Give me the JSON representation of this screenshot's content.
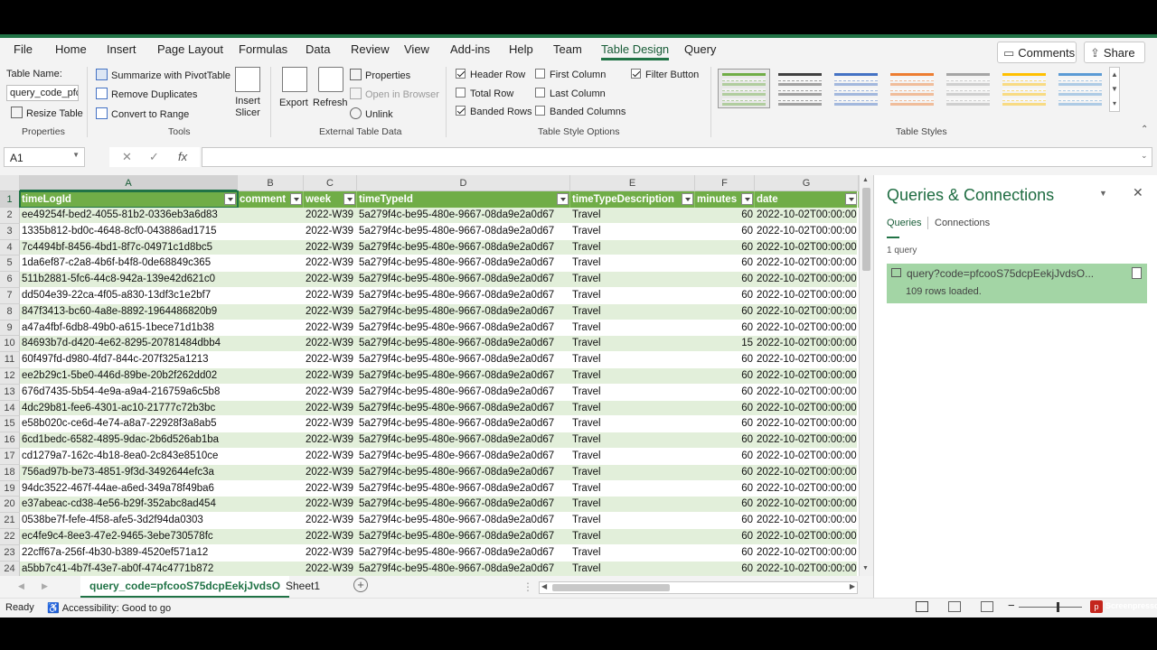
{
  "ribbon_tabs": [
    "File",
    "Home",
    "Insert",
    "Page Layout",
    "Formulas",
    "Data",
    "Review",
    "View",
    "Add-ins",
    "Help",
    "Team",
    "Table Design",
    "Query"
  ],
  "top_buttons": {
    "comments": "Comments",
    "share": "Share"
  },
  "ribbon": {
    "properties": {
      "table_name_label": "Table Name:",
      "table_name_value": "query_code_pfcc",
      "resize": "Resize Table",
      "group": "Properties"
    },
    "tools": {
      "summarize": "Summarize with PivotTable",
      "remove_dup": "Remove Duplicates",
      "convert": "Convert to Range",
      "insert_slicer": "Insert Slicer",
      "group": "Tools"
    },
    "external": {
      "export": "Export",
      "refresh": "Refresh",
      "properties": "Properties",
      "open_browser": "Open in Browser",
      "unlink": "Unlink",
      "group": "External Table Data"
    },
    "style_options": {
      "header_row": "Header Row",
      "total_row": "Total Row",
      "banded_rows": "Banded Rows",
      "first_column": "First Column",
      "last_column": "Last Column",
      "banded_columns": "Banded Columns",
      "filter_button": "Filter Button",
      "group": "Table Style Options"
    },
    "table_styles": {
      "group": "Table Styles",
      "colors": [
        "#70ad47",
        "#404040",
        "#4472c4",
        "#ed7d31",
        "#a5a5a5",
        "#ffc000",
        "#5b9bd5"
      ]
    }
  },
  "formula_bar": {
    "name_box": "A1",
    "fx": "fx",
    "formula": ""
  },
  "columns": [
    {
      "letter": "A",
      "header": "timeLogId"
    },
    {
      "letter": "B",
      "header": "comment"
    },
    {
      "letter": "C",
      "header": "week"
    },
    {
      "letter": "D",
      "header": "timeTypeId"
    },
    {
      "letter": "E",
      "header": "timeTypeDescription"
    },
    {
      "letter": "F",
      "header": "minutes"
    },
    {
      "letter": "G",
      "header": "date"
    }
  ],
  "rows": [
    {
      "n": "2",
      "a": "ee49254f-bed2-4055-81b2-0336eb3a6d83",
      "b": "",
      "c": "2022-W39",
      "d": "5a279f4c-be95-480e-9667-08da9e2a0d67",
      "e": "Travel",
      "f": "60",
      "g": "2022-10-02T00:00:00"
    },
    {
      "n": "3",
      "a": "1335b812-bd0c-4648-8cf0-043886ad1715",
      "b": "",
      "c": "2022-W39",
      "d": "5a279f4c-be95-480e-9667-08da9e2a0d67",
      "e": "Travel",
      "f": "60",
      "g": "2022-10-02T00:00:00"
    },
    {
      "n": "4",
      "a": "7c4494bf-8456-4bd1-8f7c-04971c1d8bc5",
      "b": "",
      "c": "2022-W39",
      "d": "5a279f4c-be95-480e-9667-08da9e2a0d67",
      "e": "Travel",
      "f": "60",
      "g": "2022-10-02T00:00:00"
    },
    {
      "n": "5",
      "a": "1da6ef87-c2a8-4b6f-b4f8-0de68849c365",
      "b": "",
      "c": "2022-W39",
      "d": "5a279f4c-be95-480e-9667-08da9e2a0d67",
      "e": "Travel",
      "f": "60",
      "g": "2022-10-02T00:00:00"
    },
    {
      "n": "6",
      "a": "511b2881-5fc6-44c8-942a-139e42d621c0",
      "b": "",
      "c": "2022-W39",
      "d": "5a279f4c-be95-480e-9667-08da9e2a0d67",
      "e": "Travel",
      "f": "60",
      "g": "2022-10-02T00:00:00"
    },
    {
      "n": "7",
      "a": "dd504e39-22ca-4f05-a830-13df3c1e2bf7",
      "b": "",
      "c": "2022-W39",
      "d": "5a279f4c-be95-480e-9667-08da9e2a0d67",
      "e": "Travel",
      "f": "60",
      "g": "2022-10-02T00:00:00"
    },
    {
      "n": "8",
      "a": "847f3413-bc60-4a8e-8892-1964486820b9",
      "b": "",
      "c": "2022-W39",
      "d": "5a279f4c-be95-480e-9667-08da9e2a0d67",
      "e": "Travel",
      "f": "60",
      "g": "2022-10-02T00:00:00"
    },
    {
      "n": "9",
      "a": "a47a4fbf-6db8-49b0-a615-1bece71d1b38",
      "b": "",
      "c": "2022-W39",
      "d": "5a279f4c-be95-480e-9667-08da9e2a0d67",
      "e": "Travel",
      "f": "60",
      "g": "2022-10-02T00:00:00"
    },
    {
      "n": "10",
      "a": "84693b7d-d420-4e62-8295-20781484dbb4",
      "b": "",
      "c": "2022-W39",
      "d": "5a279f4c-be95-480e-9667-08da9e2a0d67",
      "e": "Travel",
      "f": "15",
      "g": "2022-10-02T00:00:00"
    },
    {
      "n": "11",
      "a": "60f497fd-d980-4fd7-844c-207f325a1213",
      "b": "",
      "c": "2022-W39",
      "d": "5a279f4c-be95-480e-9667-08da9e2a0d67",
      "e": "Travel",
      "f": "60",
      "g": "2022-10-02T00:00:00"
    },
    {
      "n": "12",
      "a": "ee2b29c1-5be0-446d-89be-20b2f262dd02",
      "b": "",
      "c": "2022-W39",
      "d": "5a279f4c-be95-480e-9667-08da9e2a0d67",
      "e": "Travel",
      "f": "60",
      "g": "2022-10-02T00:00:00"
    },
    {
      "n": "13",
      "a": "676d7435-5b54-4e9a-a9a4-216759a6c5b8",
      "b": "",
      "c": "2022-W39",
      "d": "5a279f4c-be95-480e-9667-08da9e2a0d67",
      "e": "Travel",
      "f": "60",
      "g": "2022-10-02T00:00:00"
    },
    {
      "n": "14",
      "a": "4dc29b81-fee6-4301-ac10-21777c72b3bc",
      "b": "",
      "c": "2022-W39",
      "d": "5a279f4c-be95-480e-9667-08da9e2a0d67",
      "e": "Travel",
      "f": "60",
      "g": "2022-10-02T00:00:00"
    },
    {
      "n": "15",
      "a": "e58b020c-ce6d-4e74-a8a7-22928f3a8ab5",
      "b": "",
      "c": "2022-W39",
      "d": "5a279f4c-be95-480e-9667-08da9e2a0d67",
      "e": "Travel",
      "f": "60",
      "g": "2022-10-02T00:00:00"
    },
    {
      "n": "16",
      "a": "6cd1bedc-6582-4895-9dac-2b6d526ab1ba",
      "b": "",
      "c": "2022-W39",
      "d": "5a279f4c-be95-480e-9667-08da9e2a0d67",
      "e": "Travel",
      "f": "60",
      "g": "2022-10-02T00:00:00"
    },
    {
      "n": "17",
      "a": "cd1279a7-162c-4b18-8ea0-2c843e8510ce",
      "b": "",
      "c": "2022-W39",
      "d": "5a279f4c-be95-480e-9667-08da9e2a0d67",
      "e": "Travel",
      "f": "60",
      "g": "2022-10-02T00:00:00"
    },
    {
      "n": "18",
      "a": "756ad97b-be73-4851-9f3d-3492644efc3a",
      "b": "",
      "c": "2022-W39",
      "d": "5a279f4c-be95-480e-9667-08da9e2a0d67",
      "e": "Travel",
      "f": "60",
      "g": "2022-10-02T00:00:00"
    },
    {
      "n": "19",
      "a": "94dc3522-467f-44ae-a6ed-349a78f49ba6",
      "b": "",
      "c": "2022-W39",
      "d": "5a279f4c-be95-480e-9667-08da9e2a0d67",
      "e": "Travel",
      "f": "60",
      "g": "2022-10-02T00:00:00"
    },
    {
      "n": "20",
      "a": "e37abeac-cd38-4e56-b29f-352abc8ad454",
      "b": "",
      "c": "2022-W39",
      "d": "5a279f4c-be95-480e-9667-08da9e2a0d67",
      "e": "Travel",
      "f": "60",
      "g": "2022-10-02T00:00:00"
    },
    {
      "n": "21",
      "a": "0538be7f-fefe-4f58-afe5-3d2f94da0303",
      "b": "",
      "c": "2022-W39",
      "d": "5a279f4c-be95-480e-9667-08da9e2a0d67",
      "e": "Travel",
      "f": "60",
      "g": "2022-10-02T00:00:00"
    },
    {
      "n": "22",
      "a": "ec4fe9c4-8ee3-47e2-9465-3ebe730578fc",
      "b": "",
      "c": "2022-W39",
      "d": "5a279f4c-be95-480e-9667-08da9e2a0d67",
      "e": "Travel",
      "f": "60",
      "g": "2022-10-02T00:00:00"
    },
    {
      "n": "23",
      "a": "22cff67a-256f-4b30-b389-4520ef571a12",
      "b": "",
      "c": "2022-W39",
      "d": "5a279f4c-be95-480e-9667-08da9e2a0d67",
      "e": "Travel",
      "f": "60",
      "g": "2022-10-02T00:00:00"
    },
    {
      "n": "24",
      "a": "a5bb7c41-4b7f-43e7-ab0f-474c4771b872",
      "b": "",
      "c": "2022-W39",
      "d": "5a279f4c-be95-480e-9667-08da9e2a0d67",
      "e": "Travel",
      "f": "60",
      "g": "2022-10-02T00:00:00"
    }
  ],
  "sheets": {
    "active": "query_code=pfcooS75dcpEekjJvdsO",
    "other": "Sheet1"
  },
  "status": {
    "ready": "Ready",
    "accessibility": "Accessibility: Good to go",
    "watermark": "Screenpresso"
  },
  "pane": {
    "title": "Queries & Connections",
    "tab_queries": "Queries",
    "tab_connections": "Connections",
    "count": "1 query",
    "query_name": "query?code=pfcooS75dcpEekjJvdsO...",
    "query_status": "109 rows loaded."
  }
}
